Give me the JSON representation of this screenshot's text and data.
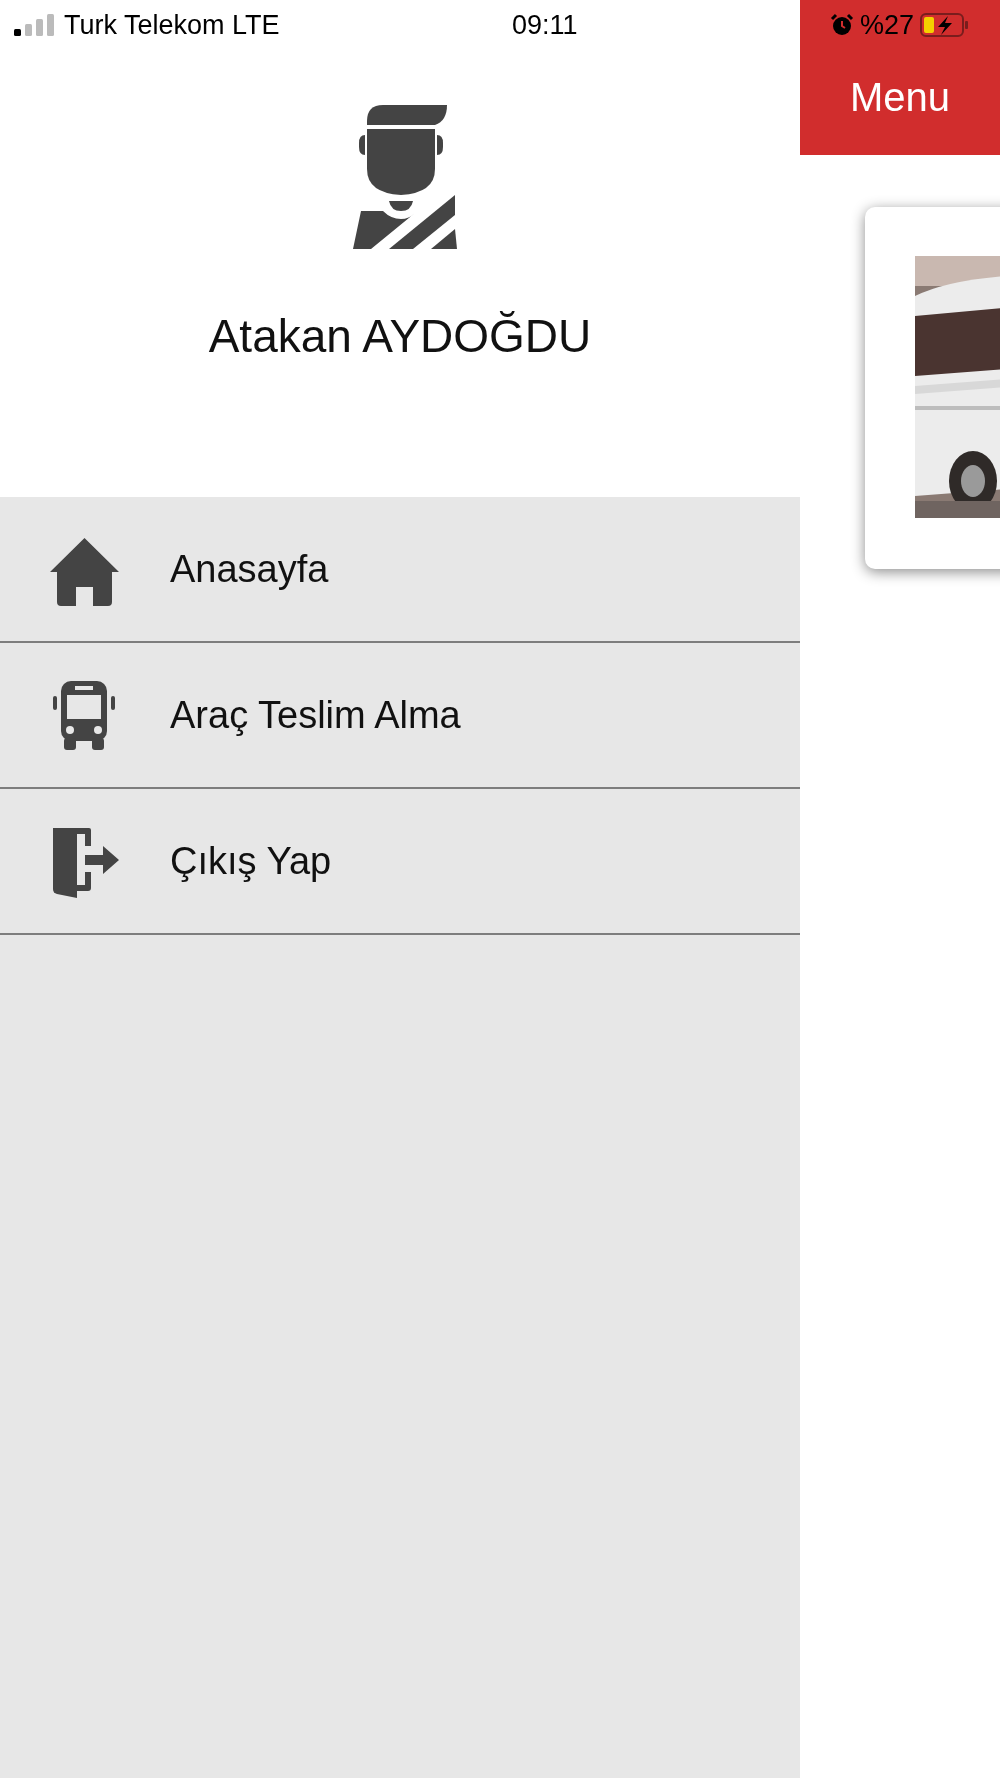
{
  "status_bar": {
    "carrier": "Turk Telekom LTE",
    "time": "09:11",
    "battery_percent": "%27"
  },
  "drawer": {
    "user_name": "Atakan AYDOĞDU",
    "items": [
      {
        "label": "Anasayfa",
        "kind": "home"
      },
      {
        "label": "Araç Teslim Alma",
        "kind": "bus"
      },
      {
        "label": "Çıkış Yap",
        "kind": "logout"
      }
    ]
  },
  "header": {
    "title": "Menu"
  }
}
